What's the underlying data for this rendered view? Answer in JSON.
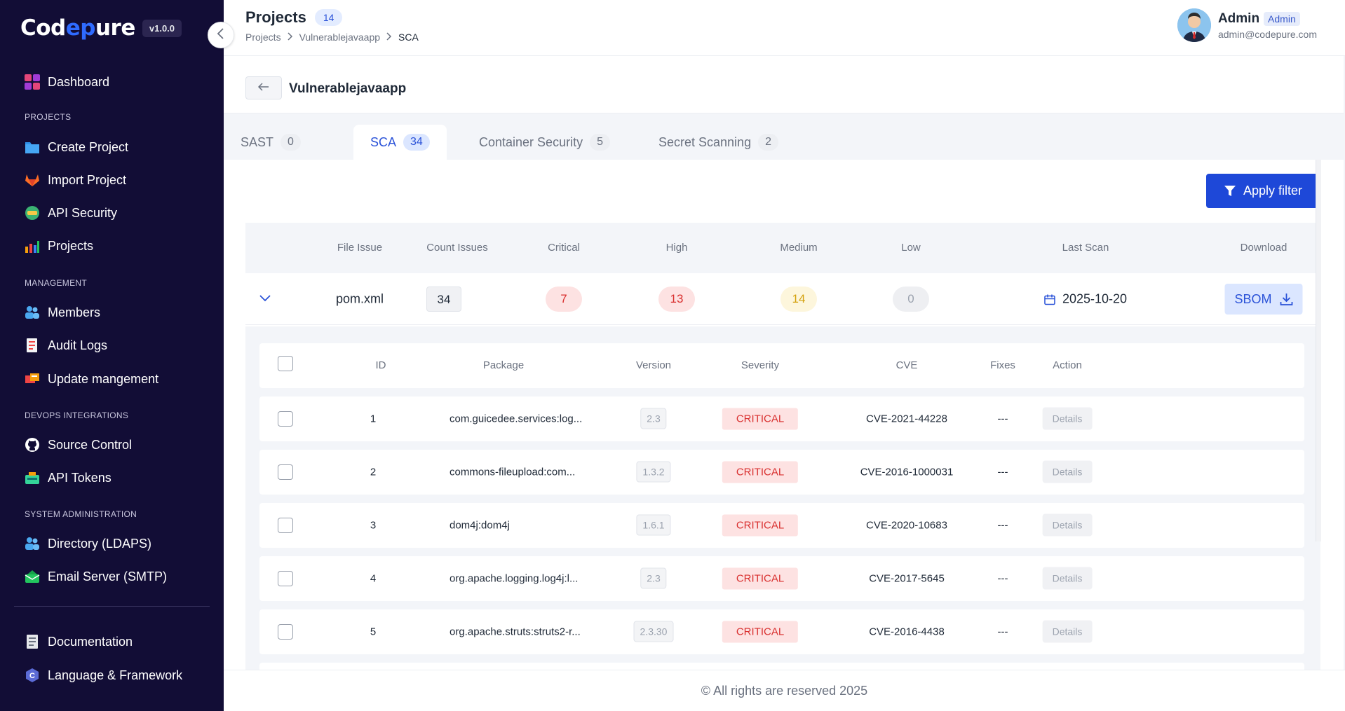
{
  "brand": {
    "logo_pre": "Cod",
    "logo_mid": "e",
    "logo_u": "p",
    "logo_post": "ure",
    "version": "v1.0.0"
  },
  "sidebar": {
    "items": [
      {
        "label": "Dashboard",
        "icon": "dashboard-icon"
      },
      {
        "label": "Create Project",
        "icon": "folder-icon"
      },
      {
        "label": "Import Project",
        "icon": "gitlab-icon"
      },
      {
        "label": "API Security",
        "icon": "api-security-icon"
      },
      {
        "label": "Projects",
        "icon": "chart-icon"
      },
      {
        "label": "Members",
        "icon": "members-icon"
      },
      {
        "label": "Audit Logs",
        "icon": "audit-logs-icon"
      },
      {
        "label": "Update mangement",
        "icon": "update-icon"
      },
      {
        "label": "Source Control",
        "icon": "github-icon"
      },
      {
        "label": "API Tokens",
        "icon": "api-tokens-icon"
      },
      {
        "label": "Directory (LDAPS)",
        "icon": "directory-icon"
      },
      {
        "label": "Email Server (SMTP)",
        "icon": "email-server-icon"
      },
      {
        "label": "Documentation",
        "icon": "documentation-icon"
      },
      {
        "label": "Language & Framework",
        "icon": "language-framework-icon"
      }
    ],
    "sections": [
      "PROJECTS",
      "MANAGEMENT",
      "DEVOPS INTEGRATIONS",
      "SYSTEM ADMINISTRATION"
    ]
  },
  "header": {
    "title": "Projects",
    "count": "14",
    "breadcrumb": [
      "Projects",
      "Vulnerablejavaapp",
      "SCA"
    ],
    "user": {
      "name": "Admin",
      "role": "Admin",
      "email": "admin@codepure.com"
    }
  },
  "project": {
    "name": "Vulnerablejavaapp"
  },
  "tabs": [
    {
      "label": "SAST",
      "count": "0",
      "active": false
    },
    {
      "label": "SCA",
      "count": "34",
      "active": true
    },
    {
      "label": "Container Security",
      "count": "5",
      "active": false
    },
    {
      "label": "Secret Scanning",
      "count": "2",
      "active": false
    }
  ],
  "filter_button": "Apply filter",
  "summary": {
    "headers": [
      "File Issue",
      "Count Issues",
      "Critical",
      "High",
      "Medium",
      "Low",
      "Last Scan",
      "Download"
    ],
    "row": {
      "file": "pom.xml",
      "count": "34",
      "critical": "7",
      "high": "13",
      "medium": "14",
      "low": "0",
      "last_scan": "2025-10-20",
      "download": "SBOM"
    }
  },
  "detail": {
    "headers": [
      "ID",
      "Package",
      "Version",
      "Severity",
      "CVE",
      "Fixes",
      "Action"
    ],
    "rows": [
      {
        "id": "1",
        "package": "com.guicedee.services:log...",
        "version": "2.3",
        "severity": "CRITICAL",
        "cve": "CVE-2021-44228",
        "fixes": "---",
        "action": "Details"
      },
      {
        "id": "2",
        "package": "commons-fileupload:com...",
        "version": "1.3.2",
        "severity": "CRITICAL",
        "cve": "CVE-2016-1000031",
        "fixes": "---",
        "action": "Details"
      },
      {
        "id": "3",
        "package": "dom4j:dom4j",
        "version": "1.6.1",
        "severity": "CRITICAL",
        "cve": "CVE-2020-10683",
        "fixes": "---",
        "action": "Details"
      },
      {
        "id": "4",
        "package": "org.apache.logging.log4j:l...",
        "version": "2.3",
        "severity": "CRITICAL",
        "cve": "CVE-2017-5645",
        "fixes": "---",
        "action": "Details"
      },
      {
        "id": "5",
        "package": "org.apache.struts:struts2-r...",
        "version": "2.3.30",
        "severity": "CRITICAL",
        "cve": "CVE-2016-4438",
        "fixes": "---",
        "action": "Details"
      }
    ]
  },
  "footer": "© All rights are reserved 2025",
  "colors": {
    "sidebar_bg": "#120d36",
    "accent": "#1e48d8",
    "critical": "#d9302f",
    "medium": "#d4a20e"
  }
}
